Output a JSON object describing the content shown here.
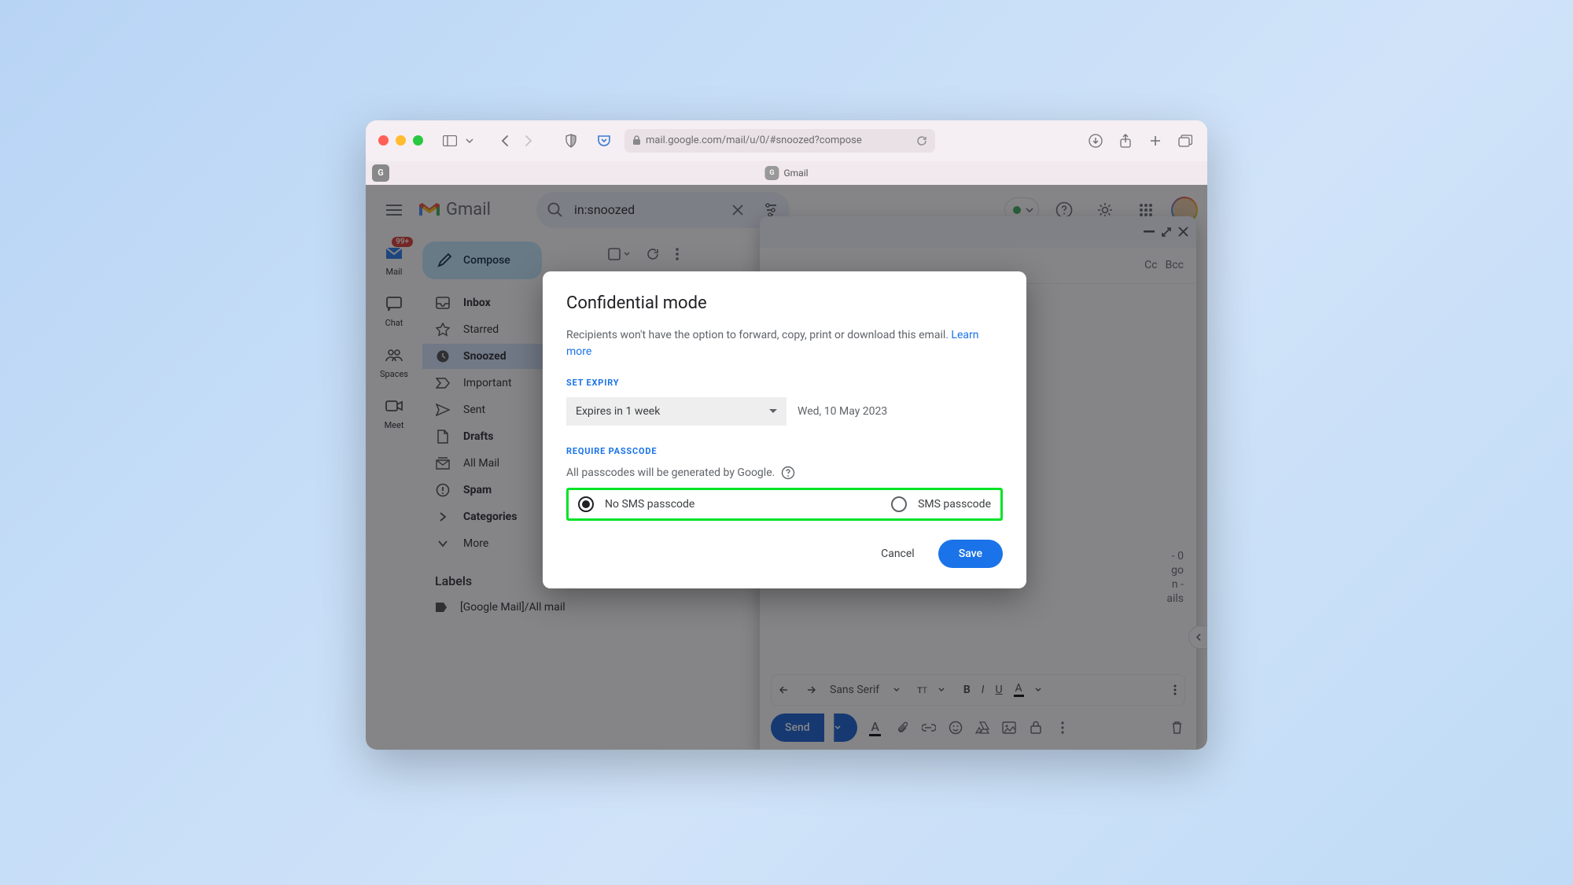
{
  "browser": {
    "url": "mail.google.com/mail/u/0/#snoozed?compose",
    "tab_title": "Gmail",
    "favicon_letter": "G"
  },
  "gmail": {
    "logo_text": "Gmail",
    "search_value": "in:snoozed",
    "unread_badge": "99+"
  },
  "rail": {
    "mail": "Mail",
    "chat": "Chat",
    "spaces": "Spaces",
    "meet": "Meet"
  },
  "sidebar": {
    "compose": "Compose",
    "items": [
      {
        "label": "Inbox",
        "bold": true
      },
      {
        "label": "Starred",
        "bold": false
      },
      {
        "label": "Snoozed",
        "bold": true,
        "active": true
      },
      {
        "label": "Important",
        "bold": false
      },
      {
        "label": "Sent",
        "bold": false
      },
      {
        "label": "Drafts",
        "bold": true
      },
      {
        "label": "All Mail",
        "bold": false
      },
      {
        "label": "Spam",
        "bold": true
      },
      {
        "label": "Categories",
        "bold": true
      },
      {
        "label": "More",
        "bold": false
      }
    ],
    "labels_header": "Labels",
    "label_1": "[Google Mail]/All mail"
  },
  "compose_win": {
    "cc": "Cc",
    "bcc": "Bcc",
    "body_lines": [
      "- 0",
      "go",
      "n -",
      "ails"
    ],
    "font": "Sans Serif",
    "send": "Send"
  },
  "modal": {
    "title": "Confidential mode",
    "desc": "Recipients won't have the option to forward, copy, print or download this email. ",
    "learn_more": "Learn more",
    "set_expiry_label": "SET EXPIRY",
    "expiry_value": "Expires in 1 week",
    "expiry_date": "Wed, 10 May 2023",
    "require_passcode_label": "REQUIRE PASSCODE",
    "passcode_desc": "All passcodes will be generated by Google.",
    "radio_no_sms": "No SMS passcode",
    "radio_sms": "SMS passcode",
    "cancel": "Cancel",
    "save": "Save"
  }
}
